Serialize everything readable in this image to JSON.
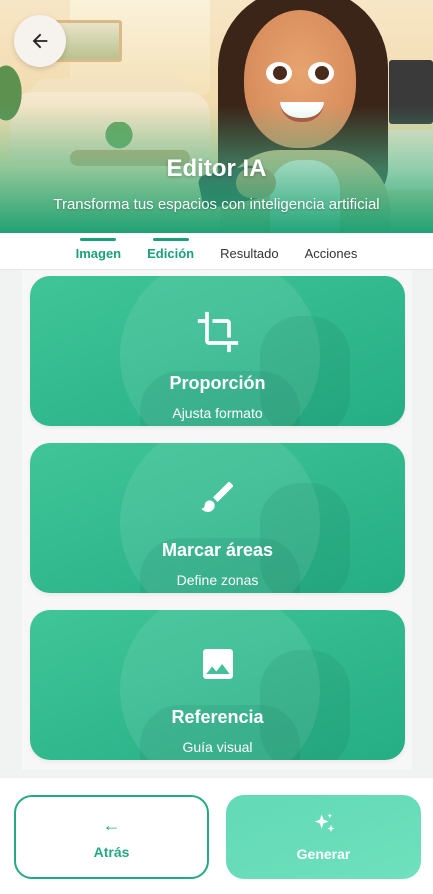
{
  "header": {
    "title": "Editor IA",
    "subtitle": "Transforma tus espacios con inteligencia artificial",
    "back_icon": "arrow-left-icon"
  },
  "tabs": [
    {
      "label": "Imagen",
      "active": true
    },
    {
      "label": "Edición",
      "active": true
    },
    {
      "label": "Resultado",
      "active": false
    },
    {
      "label": "Acciones",
      "active": false
    }
  ],
  "cards": [
    {
      "title": "Proporción",
      "subtitle": "Ajusta formato",
      "icon": "crop-icon"
    },
    {
      "title": "Marcar áreas",
      "subtitle": "Define zonas",
      "icon": "brush-icon"
    },
    {
      "title": "Referencia",
      "subtitle": "Guía visual",
      "icon": "image-icon"
    }
  ],
  "footer": {
    "back_arrow": "←",
    "back_label": "Atrás",
    "generate_label": "Generar",
    "generate_icon": "sparkles-icon"
  },
  "colors": {
    "accent": "#19a27a",
    "card": "#2fb98b",
    "generate_button": "#67dcb8"
  }
}
